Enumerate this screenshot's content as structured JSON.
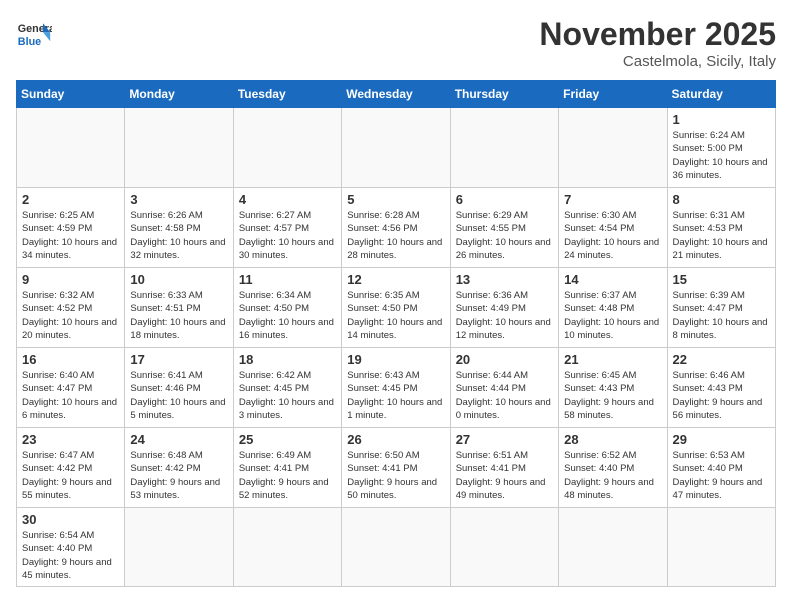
{
  "header": {
    "logo_general": "General",
    "logo_blue": "Blue",
    "month_title": "November 2025",
    "location": "Castelmola, Sicily, Italy"
  },
  "days_of_week": [
    "Sunday",
    "Monday",
    "Tuesday",
    "Wednesday",
    "Thursday",
    "Friday",
    "Saturday"
  ],
  "weeks": [
    [
      {
        "day": "",
        "info": ""
      },
      {
        "day": "",
        "info": ""
      },
      {
        "day": "",
        "info": ""
      },
      {
        "day": "",
        "info": ""
      },
      {
        "day": "",
        "info": ""
      },
      {
        "day": "",
        "info": ""
      },
      {
        "day": "1",
        "info": "Sunrise: 6:24 AM\nSunset: 5:00 PM\nDaylight: 10 hours and 36 minutes."
      }
    ],
    [
      {
        "day": "2",
        "info": "Sunrise: 6:25 AM\nSunset: 4:59 PM\nDaylight: 10 hours and 34 minutes."
      },
      {
        "day": "3",
        "info": "Sunrise: 6:26 AM\nSunset: 4:58 PM\nDaylight: 10 hours and 32 minutes."
      },
      {
        "day": "4",
        "info": "Sunrise: 6:27 AM\nSunset: 4:57 PM\nDaylight: 10 hours and 30 minutes."
      },
      {
        "day": "5",
        "info": "Sunrise: 6:28 AM\nSunset: 4:56 PM\nDaylight: 10 hours and 28 minutes."
      },
      {
        "day": "6",
        "info": "Sunrise: 6:29 AM\nSunset: 4:55 PM\nDaylight: 10 hours and 26 minutes."
      },
      {
        "day": "7",
        "info": "Sunrise: 6:30 AM\nSunset: 4:54 PM\nDaylight: 10 hours and 24 minutes."
      },
      {
        "day": "8",
        "info": "Sunrise: 6:31 AM\nSunset: 4:53 PM\nDaylight: 10 hours and 21 minutes."
      }
    ],
    [
      {
        "day": "9",
        "info": "Sunrise: 6:32 AM\nSunset: 4:52 PM\nDaylight: 10 hours and 20 minutes."
      },
      {
        "day": "10",
        "info": "Sunrise: 6:33 AM\nSunset: 4:51 PM\nDaylight: 10 hours and 18 minutes."
      },
      {
        "day": "11",
        "info": "Sunrise: 6:34 AM\nSunset: 4:50 PM\nDaylight: 10 hours and 16 minutes."
      },
      {
        "day": "12",
        "info": "Sunrise: 6:35 AM\nSunset: 4:50 PM\nDaylight: 10 hours and 14 minutes."
      },
      {
        "day": "13",
        "info": "Sunrise: 6:36 AM\nSunset: 4:49 PM\nDaylight: 10 hours and 12 minutes."
      },
      {
        "day": "14",
        "info": "Sunrise: 6:37 AM\nSunset: 4:48 PM\nDaylight: 10 hours and 10 minutes."
      },
      {
        "day": "15",
        "info": "Sunrise: 6:39 AM\nSunset: 4:47 PM\nDaylight: 10 hours and 8 minutes."
      }
    ],
    [
      {
        "day": "16",
        "info": "Sunrise: 6:40 AM\nSunset: 4:47 PM\nDaylight: 10 hours and 6 minutes."
      },
      {
        "day": "17",
        "info": "Sunrise: 6:41 AM\nSunset: 4:46 PM\nDaylight: 10 hours and 5 minutes."
      },
      {
        "day": "18",
        "info": "Sunrise: 6:42 AM\nSunset: 4:45 PM\nDaylight: 10 hours and 3 minutes."
      },
      {
        "day": "19",
        "info": "Sunrise: 6:43 AM\nSunset: 4:45 PM\nDaylight: 10 hours and 1 minute."
      },
      {
        "day": "20",
        "info": "Sunrise: 6:44 AM\nSunset: 4:44 PM\nDaylight: 10 hours and 0 minutes."
      },
      {
        "day": "21",
        "info": "Sunrise: 6:45 AM\nSunset: 4:43 PM\nDaylight: 9 hours and 58 minutes."
      },
      {
        "day": "22",
        "info": "Sunrise: 6:46 AM\nSunset: 4:43 PM\nDaylight: 9 hours and 56 minutes."
      }
    ],
    [
      {
        "day": "23",
        "info": "Sunrise: 6:47 AM\nSunset: 4:42 PM\nDaylight: 9 hours and 55 minutes."
      },
      {
        "day": "24",
        "info": "Sunrise: 6:48 AM\nSunset: 4:42 PM\nDaylight: 9 hours and 53 minutes."
      },
      {
        "day": "25",
        "info": "Sunrise: 6:49 AM\nSunset: 4:41 PM\nDaylight: 9 hours and 52 minutes."
      },
      {
        "day": "26",
        "info": "Sunrise: 6:50 AM\nSunset: 4:41 PM\nDaylight: 9 hours and 50 minutes."
      },
      {
        "day": "27",
        "info": "Sunrise: 6:51 AM\nSunset: 4:41 PM\nDaylight: 9 hours and 49 minutes."
      },
      {
        "day": "28",
        "info": "Sunrise: 6:52 AM\nSunset: 4:40 PM\nDaylight: 9 hours and 48 minutes."
      },
      {
        "day": "29",
        "info": "Sunrise: 6:53 AM\nSunset: 4:40 PM\nDaylight: 9 hours and 47 minutes."
      }
    ],
    [
      {
        "day": "30",
        "info": "Sunrise: 6:54 AM\nSunset: 4:40 PM\nDaylight: 9 hours and 45 minutes."
      },
      {
        "day": "",
        "info": ""
      },
      {
        "day": "",
        "info": ""
      },
      {
        "day": "",
        "info": ""
      },
      {
        "day": "",
        "info": ""
      },
      {
        "day": "",
        "info": ""
      },
      {
        "day": "",
        "info": ""
      }
    ]
  ]
}
